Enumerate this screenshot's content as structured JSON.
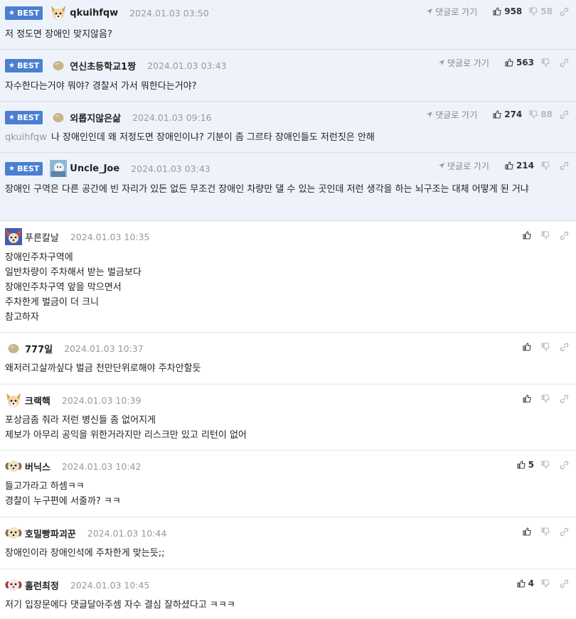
{
  "labels": {
    "best": "BEST",
    "goto": "댓글로 가기"
  },
  "best_comments": [
    {
      "nick": "qkuihfqw",
      "date": "2024.01.03 03:50",
      "up": "958",
      "down": "58",
      "avatar_icon": "dog-face-icon",
      "mention": "",
      "text": "저 정도면 장애인 맞지않음?"
    },
    {
      "nick": "연신초등학교1짱",
      "date": "2024.01.03 03:43",
      "up": "563",
      "down": "",
      "avatar_icon": "potato-icon",
      "mention": "",
      "text": "자수한다는거야 뭐야? 경찰서 가서 뭐한다는거야?"
    },
    {
      "nick": "외롭지않은삶",
      "date": "2024.01.03 09:16",
      "up": "274",
      "down": "88",
      "avatar_icon": "potato-icon",
      "mention": "qkuihfqw",
      "text": "나 장애인인데 왜 저정도면 장애인이냐? 기분이 좀 그르타 장애인들도 저런짓은 안해"
    },
    {
      "nick": "Uncle_Joe",
      "date": "2024.01.03 03:43",
      "up": "214",
      "down": "",
      "avatar_icon": "photo-avatar-icon",
      "mention": "",
      "text": "장애인 구역은 다른 공간에 빈 자리가 있든 없든 무조건 장애인 차량만 댈 수 있는 곳인데 저런 생각을 하는 뇌구조는 대체 어떻게 된 거냐"
    }
  ],
  "comments": [
    {
      "nick": "푸른칼날",
      "date": "2024.01.03 10:35",
      "up": "",
      "avatar_icon": "colorful-dog-icon",
      "lines": [
        "장애인주차구역에",
        "일반차량이 주차해서 받는 벌금보다",
        "장애인주차구역 앞을 막으면서",
        "주차한게 벌금이 더 크니",
        "참고하자"
      ]
    },
    {
      "nick": "777일",
      "date": "2024.01.03 10:37",
      "up": "",
      "avatar_icon": "potato-icon",
      "lines": [
        "왜저러고살까싶다 벌금 천만단위로해야 주차안할듯"
      ]
    },
    {
      "nick": "크랙핵",
      "date": "2024.01.03 10:39",
      "up": "",
      "avatar_icon": "dog-face-icon",
      "lines": [
        "포상금좀 줘라 저런 병신들 좀 없어지게",
        "제보가 아무리 공익을 위한거라지만 리스크만 있고 리턴이 없어"
      ]
    },
    {
      "nick": "버닉스",
      "date": "2024.01.03 10:42",
      "up": "5",
      "avatar_icon": "puppy-face-icon",
      "lines": [
        "들고가라고 하셈ㅋㅋ",
        "경찰이 누구편에 서줄까? ㅋㅋ"
      ]
    },
    {
      "nick": "호밀빵파괴꾼",
      "date": "2024.01.03 10:44",
      "up": "",
      "avatar_icon": "puppy-face-icon",
      "lines": [
        "장애인이라 장애인석에 주차한게 맞는듯;;"
      ]
    },
    {
      "nick": "홀런최정",
      "date": "2024.01.03 10:45",
      "up": "4",
      "avatar_icon": "red-dog-icon",
      "lines": [
        "저기 입장문에다 댓글달아주셈 자수 결심 잘하셨다고 ㅋㅋㅋ"
      ]
    }
  ]
}
